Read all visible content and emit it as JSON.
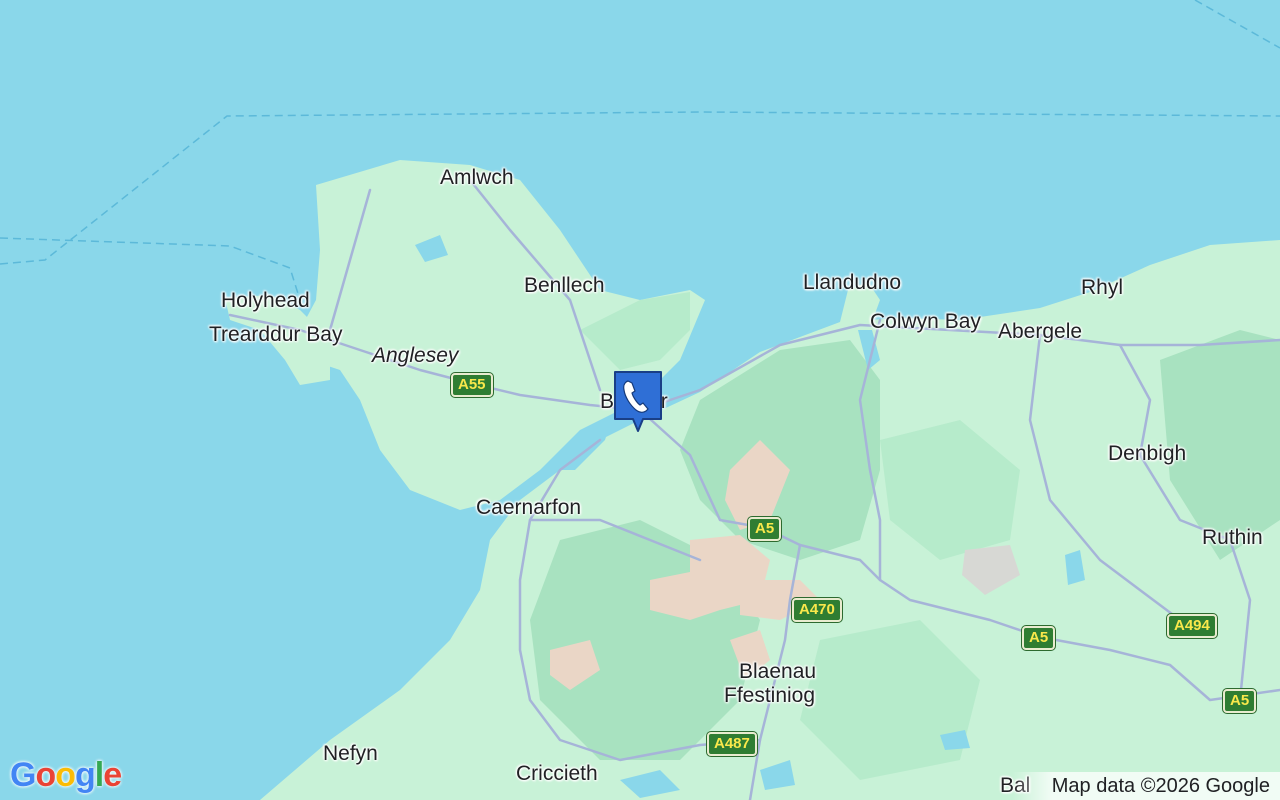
{
  "map": {
    "region": "North Wales",
    "colors": {
      "sea": "#8ad7ea",
      "land": "#c8f2d7",
      "hills": "#a8e2c0",
      "mountains": "#ead6c6",
      "roads": "#a6b4d8",
      "marker": "#2f6fd6"
    }
  },
  "places": [
    {
      "key": "amlwch",
      "label": "Amlwch"
    },
    {
      "key": "benllech",
      "label": "Benllech"
    },
    {
      "key": "holyhead",
      "label": "Holyhead"
    },
    {
      "key": "trearddur",
      "label": "Trearddur Bay"
    },
    {
      "key": "anglesey",
      "label": "Anglesey"
    },
    {
      "key": "bangor",
      "label": "Bangor"
    },
    {
      "key": "llandudno",
      "label": "Llandudno"
    },
    {
      "key": "colwyn",
      "label": "Colwyn Bay"
    },
    {
      "key": "abergele",
      "label": "Abergele"
    },
    {
      "key": "rhyl",
      "label": "Rhyl"
    },
    {
      "key": "denbigh",
      "label": "Denbigh"
    },
    {
      "key": "ruthin",
      "label": "Ruthin"
    },
    {
      "key": "caernarfon",
      "label": "Caernarfon"
    },
    {
      "key": "blaenau1",
      "label": "Blaenau"
    },
    {
      "key": "blaenau2",
      "label": "Ffestiniog"
    },
    {
      "key": "nefyn",
      "label": "Nefyn"
    },
    {
      "key": "criccieth",
      "label": "Criccieth"
    },
    {
      "key": "bala",
      "label": "Bal"
    }
  ],
  "roads": [
    {
      "key": "a55",
      "label": "A55"
    },
    {
      "key": "a5_mid",
      "label": "A5"
    },
    {
      "key": "a470",
      "label": "A470"
    },
    {
      "key": "a5_east",
      "label": "A5"
    },
    {
      "key": "a494",
      "label": "A494"
    },
    {
      "key": "a5_far",
      "label": "A5"
    },
    {
      "key": "a487",
      "label": "A487"
    }
  ],
  "marker": {
    "icon": "phone-icon"
  },
  "branding": {
    "logo_text": "Google"
  },
  "attribution": "Map data ©2026 Google"
}
